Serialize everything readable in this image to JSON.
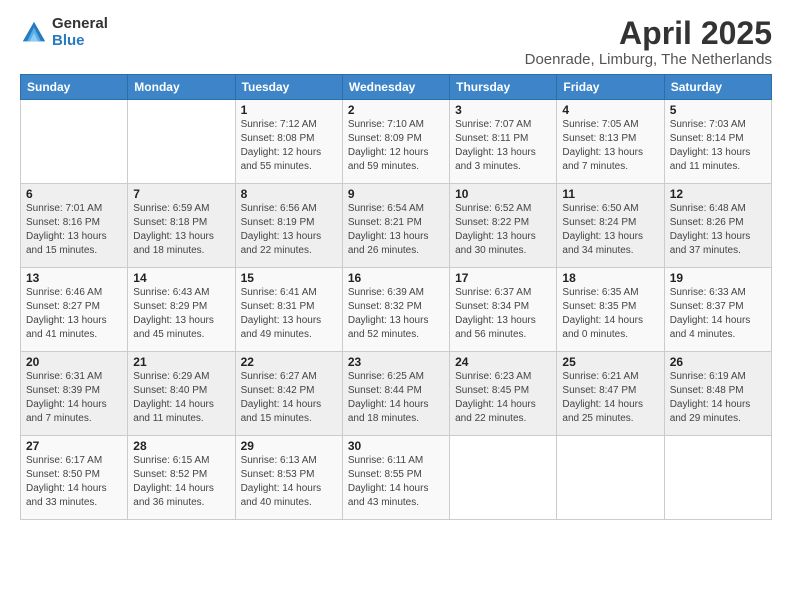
{
  "logo": {
    "general": "General",
    "blue": "Blue"
  },
  "title": "April 2025",
  "subtitle": "Doenrade, Limburg, The Netherlands",
  "days_of_week": [
    "Sunday",
    "Monday",
    "Tuesday",
    "Wednesday",
    "Thursday",
    "Friday",
    "Saturday"
  ],
  "weeks": [
    [
      {
        "day": "",
        "info": ""
      },
      {
        "day": "",
        "info": ""
      },
      {
        "day": "1",
        "info": "Sunrise: 7:12 AM\nSunset: 8:08 PM\nDaylight: 12 hours and 55 minutes."
      },
      {
        "day": "2",
        "info": "Sunrise: 7:10 AM\nSunset: 8:09 PM\nDaylight: 12 hours and 59 minutes."
      },
      {
        "day": "3",
        "info": "Sunrise: 7:07 AM\nSunset: 8:11 PM\nDaylight: 13 hours and 3 minutes."
      },
      {
        "day": "4",
        "info": "Sunrise: 7:05 AM\nSunset: 8:13 PM\nDaylight: 13 hours and 7 minutes."
      },
      {
        "day": "5",
        "info": "Sunrise: 7:03 AM\nSunset: 8:14 PM\nDaylight: 13 hours and 11 minutes."
      }
    ],
    [
      {
        "day": "6",
        "info": "Sunrise: 7:01 AM\nSunset: 8:16 PM\nDaylight: 13 hours and 15 minutes."
      },
      {
        "day": "7",
        "info": "Sunrise: 6:59 AM\nSunset: 8:18 PM\nDaylight: 13 hours and 18 minutes."
      },
      {
        "day": "8",
        "info": "Sunrise: 6:56 AM\nSunset: 8:19 PM\nDaylight: 13 hours and 22 minutes."
      },
      {
        "day": "9",
        "info": "Sunrise: 6:54 AM\nSunset: 8:21 PM\nDaylight: 13 hours and 26 minutes."
      },
      {
        "day": "10",
        "info": "Sunrise: 6:52 AM\nSunset: 8:22 PM\nDaylight: 13 hours and 30 minutes."
      },
      {
        "day": "11",
        "info": "Sunrise: 6:50 AM\nSunset: 8:24 PM\nDaylight: 13 hours and 34 minutes."
      },
      {
        "day": "12",
        "info": "Sunrise: 6:48 AM\nSunset: 8:26 PM\nDaylight: 13 hours and 37 minutes."
      }
    ],
    [
      {
        "day": "13",
        "info": "Sunrise: 6:46 AM\nSunset: 8:27 PM\nDaylight: 13 hours and 41 minutes."
      },
      {
        "day": "14",
        "info": "Sunrise: 6:43 AM\nSunset: 8:29 PM\nDaylight: 13 hours and 45 minutes."
      },
      {
        "day": "15",
        "info": "Sunrise: 6:41 AM\nSunset: 8:31 PM\nDaylight: 13 hours and 49 minutes."
      },
      {
        "day": "16",
        "info": "Sunrise: 6:39 AM\nSunset: 8:32 PM\nDaylight: 13 hours and 52 minutes."
      },
      {
        "day": "17",
        "info": "Sunrise: 6:37 AM\nSunset: 8:34 PM\nDaylight: 13 hours and 56 minutes."
      },
      {
        "day": "18",
        "info": "Sunrise: 6:35 AM\nSunset: 8:35 PM\nDaylight: 14 hours and 0 minutes."
      },
      {
        "day": "19",
        "info": "Sunrise: 6:33 AM\nSunset: 8:37 PM\nDaylight: 14 hours and 4 minutes."
      }
    ],
    [
      {
        "day": "20",
        "info": "Sunrise: 6:31 AM\nSunset: 8:39 PM\nDaylight: 14 hours and 7 minutes."
      },
      {
        "day": "21",
        "info": "Sunrise: 6:29 AM\nSunset: 8:40 PM\nDaylight: 14 hours and 11 minutes."
      },
      {
        "day": "22",
        "info": "Sunrise: 6:27 AM\nSunset: 8:42 PM\nDaylight: 14 hours and 15 minutes."
      },
      {
        "day": "23",
        "info": "Sunrise: 6:25 AM\nSunset: 8:44 PM\nDaylight: 14 hours and 18 minutes."
      },
      {
        "day": "24",
        "info": "Sunrise: 6:23 AM\nSunset: 8:45 PM\nDaylight: 14 hours and 22 minutes."
      },
      {
        "day": "25",
        "info": "Sunrise: 6:21 AM\nSunset: 8:47 PM\nDaylight: 14 hours and 25 minutes."
      },
      {
        "day": "26",
        "info": "Sunrise: 6:19 AM\nSunset: 8:48 PM\nDaylight: 14 hours and 29 minutes."
      }
    ],
    [
      {
        "day": "27",
        "info": "Sunrise: 6:17 AM\nSunset: 8:50 PM\nDaylight: 14 hours and 33 minutes."
      },
      {
        "day": "28",
        "info": "Sunrise: 6:15 AM\nSunset: 8:52 PM\nDaylight: 14 hours and 36 minutes."
      },
      {
        "day": "29",
        "info": "Sunrise: 6:13 AM\nSunset: 8:53 PM\nDaylight: 14 hours and 40 minutes."
      },
      {
        "day": "30",
        "info": "Sunrise: 6:11 AM\nSunset: 8:55 PM\nDaylight: 14 hours and 43 minutes."
      },
      {
        "day": "",
        "info": ""
      },
      {
        "day": "",
        "info": ""
      },
      {
        "day": "",
        "info": ""
      }
    ]
  ]
}
